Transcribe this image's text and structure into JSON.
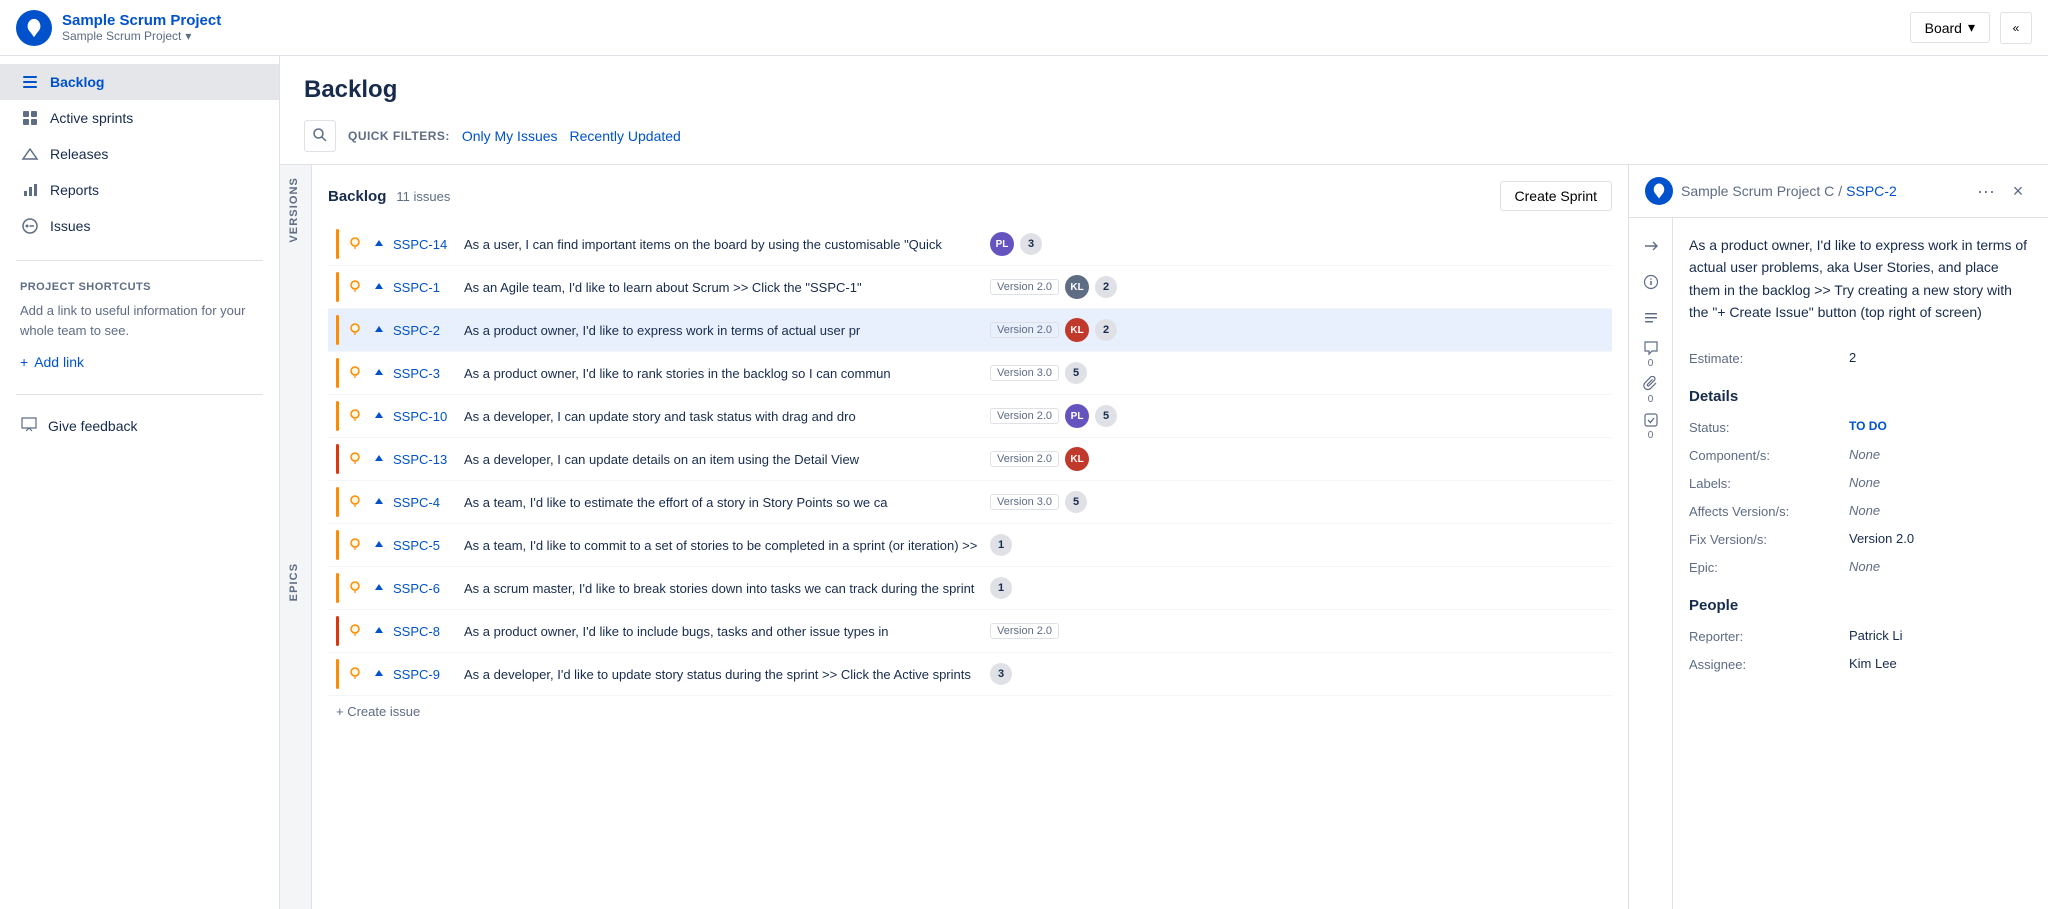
{
  "app": {
    "logo_label": "Jira",
    "project_name": "Sample Scrum Project",
    "project_sub": "Sample Scrum Project",
    "board_label": "Board",
    "collapse_label": "«"
  },
  "sidebar": {
    "items": [
      {
        "id": "backlog",
        "label": "Backlog",
        "icon": "list-icon",
        "active": true
      },
      {
        "id": "active-sprints",
        "label": "Active sprints",
        "icon": "sprint-icon",
        "active": false
      },
      {
        "id": "releases",
        "label": "Releases",
        "icon": "release-icon",
        "active": false
      },
      {
        "id": "reports",
        "label": "Reports",
        "icon": "chart-icon",
        "active": false
      },
      {
        "id": "issues",
        "label": "Issues",
        "icon": "issues-icon",
        "active": false
      }
    ],
    "shortcuts": {
      "title": "PROJECT SHORTCUTS",
      "desc": "Add a link to useful information for your whole team to see.",
      "add_link": "Add link"
    },
    "feedback": {
      "label": "Give feedback"
    }
  },
  "header": {
    "page_title": "Backlog",
    "quick_filters_label": "QUICK FILTERS:",
    "filter_my_issues": "Only My Issues",
    "filter_recently_updated": "Recently Updated"
  },
  "versions_bar": {
    "versions_label": "VERSIONS",
    "epics_label": "EPICS"
  },
  "backlog": {
    "title": "Backlog",
    "issue_count": "11 issues",
    "create_sprint_label": "Create Sprint",
    "create_issue_label": "+ Create issue",
    "issues": [
      {
        "id": "SSPC-14",
        "priority_color": "orange",
        "type": "story",
        "priority": "up",
        "summary": "As a user, I can find important items on the board by using the customisable \"Quick",
        "version": "",
        "avatar_color": "#6554c0",
        "avatar_initials": "PL",
        "count": "3"
      },
      {
        "id": "SSPC-1",
        "priority_color": "orange",
        "type": "story",
        "priority": "up",
        "summary": "As an Agile team, I'd like to learn about Scrum >> Click the \"SSPC-1\"",
        "version": "Version 2.0",
        "avatar_color": "#5e6c84",
        "avatar_initials": "KL",
        "count": "2"
      },
      {
        "id": "SSPC-2",
        "priority_color": "orange",
        "type": "story",
        "priority": "up",
        "summary": "As a product owner, I'd like to express work in terms of actual user pr",
        "version": "Version 2.0",
        "avatar_color": "#c0392b",
        "avatar_initials": "KL",
        "count": "2",
        "selected": true
      },
      {
        "id": "SSPC-3",
        "priority_color": "orange",
        "type": "story",
        "priority": "up",
        "summary": "As a product owner, I'd like to rank stories in the backlog so I can commun",
        "version": "Version 3.0",
        "avatar_color": "#5e6c84",
        "avatar_initials": "",
        "count": "5"
      },
      {
        "id": "SSPC-10",
        "priority_color": "orange",
        "type": "story",
        "priority": "up",
        "summary": "As a developer, I can update story and task status with drag and dro",
        "version": "Version 2.0",
        "avatar_color": "#6554c0",
        "avatar_initials": "PL",
        "count": "5"
      },
      {
        "id": "SSPC-13",
        "priority_color": "red",
        "type": "story",
        "priority": "up",
        "summary": "As a developer, I can update details on an item using the Detail View",
        "version": "Version 2.0",
        "avatar_color": "#c0392b",
        "avatar_initials": "KL",
        "count": ""
      },
      {
        "id": "SSPC-4",
        "priority_color": "orange",
        "type": "story",
        "priority": "up",
        "summary": "As a team, I'd like to estimate the effort of a story in Story Points so we ca",
        "version": "Version 3.0",
        "avatar_color": "#5e6c84",
        "avatar_initials": "",
        "count": "5"
      },
      {
        "id": "SSPC-5",
        "priority_color": "orange",
        "type": "story",
        "priority": "up",
        "summary": "As a team, I'd like to commit to a set of stories to be completed in a sprint (or iteration) >>",
        "version": "",
        "avatar_color": "#5e6c84",
        "avatar_initials": "",
        "count": "1"
      },
      {
        "id": "SSPC-6",
        "priority_color": "orange",
        "type": "story",
        "priority": "up",
        "summary": "As a scrum master, I'd like to break stories down into tasks we can track during the sprint",
        "version": "",
        "avatar_color": "#5e6c84",
        "avatar_initials": "",
        "count": "1"
      },
      {
        "id": "SSPC-8",
        "priority_color": "red",
        "type": "story",
        "priority": "up",
        "summary": "As a product owner, I'd like to include bugs, tasks and other issue types in",
        "version": "Version 2.0",
        "avatar_color": "#5e6c84",
        "avatar_initials": "",
        "count": ""
      },
      {
        "id": "SSPC-9",
        "priority_color": "orange",
        "type": "story",
        "priority": "up",
        "summary": "As a developer, I'd like to update story status during the sprint >> Click the Active sprints",
        "version": "",
        "avatar_color": "#5e6c84",
        "avatar_initials": "",
        "count": "3"
      }
    ]
  },
  "detail": {
    "breadcrumb_project": "Sample Scrum Project C",
    "breadcrumb_separator": "/",
    "breadcrumb_issue": "SSPC-2",
    "description": "As a product owner, I'd like to express work in terms of actual user problems, aka User Stories, and place them in the backlog >> Try creating a new story with the \"+  Create Issue\" button (top right of screen)",
    "estimate_label": "Estimate:",
    "estimate_value": "2",
    "details_title": "Details",
    "status_label": "Status:",
    "status_value": "TO DO",
    "components_label": "Component/s:",
    "components_value": "None",
    "labels_label": "Labels:",
    "labels_value": "None",
    "affects_label": "Affects Version/s:",
    "affects_value": "None",
    "fix_label": "Fix Version/s:",
    "fix_value": "Version 2.0",
    "epic_label": "Epic:",
    "epic_value": "None",
    "people_title": "People",
    "reporter_label": "Reporter:",
    "reporter_value": "Patrick Li",
    "assignee_label": "Assignee:",
    "assignee_value": "Kim Lee",
    "comments_count": "0",
    "attach_count": "0",
    "check_count": "0"
  }
}
